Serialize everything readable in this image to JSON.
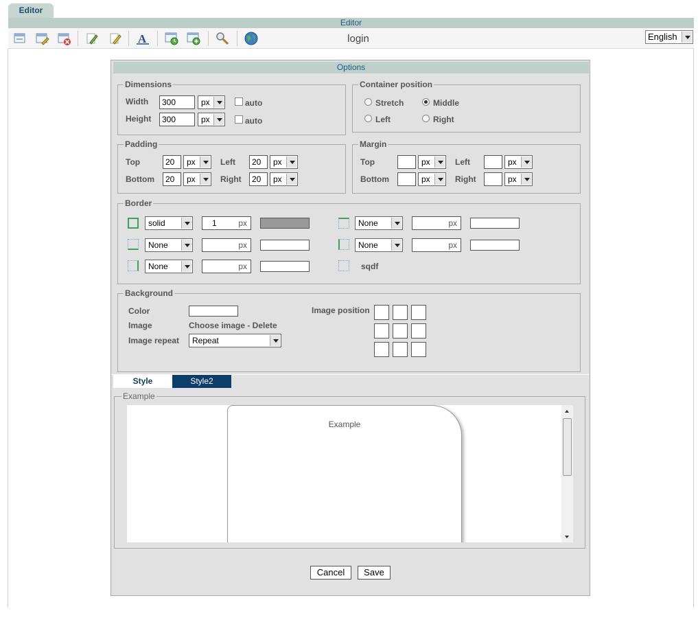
{
  "top_tab": "Editor",
  "header_bar": "Editor",
  "page_title": "login",
  "language": "English",
  "dialog_title": "Options",
  "dimensions": {
    "legend": "Dimensions",
    "width_label": "Width",
    "width_value": "300",
    "width_unit": "px",
    "height_label": "Height",
    "height_value": "300",
    "height_unit": "px",
    "auto_label": "auto"
  },
  "container_position": {
    "legend": "Container position",
    "stretch": "Stretch",
    "middle": "Middle",
    "left": "Left",
    "right": "Right",
    "selected": "Middle"
  },
  "padding": {
    "legend": "Padding",
    "top_label": "Top",
    "top_value": "20",
    "left_label": "Left",
    "left_value": "20",
    "bottom_label": "Bottom",
    "bottom_value": "20",
    "right_label": "Right",
    "right_value": "20",
    "unit": "px"
  },
  "margin": {
    "legend": "Margin",
    "top_label": "Top",
    "left_label": "Left",
    "bottom_label": "Bottom",
    "right_label": "Right",
    "unit": "px"
  },
  "border": {
    "legend": "Border",
    "unit": "px",
    "all_style": "solid",
    "all_width": "1",
    "all_color": "#999999",
    "none": "None",
    "name_label": "sqdf"
  },
  "background": {
    "legend": "Background",
    "color_label": "Color",
    "image_label": "Image",
    "image_actions": "Choose image - Delete",
    "repeat_label": "Image repeat",
    "repeat_value": "Repeat",
    "position_label": "Image position"
  },
  "tabs": {
    "style": "Style",
    "style2": "Style2"
  },
  "example": {
    "legend": "Example",
    "text": "Example"
  },
  "buttons": {
    "cancel": "Cancel",
    "save": "Save"
  },
  "icons": [
    "page-icon",
    "page-edit-icon",
    "page-delete-icon",
    "edit-icon",
    "edit2-icon",
    "font-icon",
    "window-clock-icon",
    "window-add-icon",
    "search-icon",
    "globe-icon"
  ]
}
